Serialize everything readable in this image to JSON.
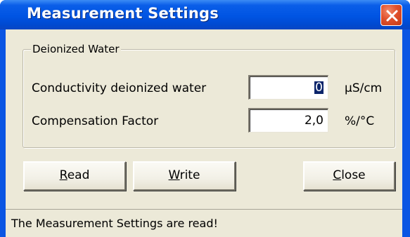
{
  "window": {
    "title": "Measurement Settings",
    "close_icon": "close-icon"
  },
  "group": {
    "legend": "Deionized Water"
  },
  "fields": {
    "conductivity": {
      "label": "Conductivity deionized water",
      "value": "0",
      "unit": "µS/cm"
    },
    "compensation": {
      "label": "Compensation Factor",
      "value": "2,0",
      "unit": "%/°C"
    }
  },
  "buttons": {
    "read": {
      "mnemonic": "R",
      "rest": "ead"
    },
    "write": {
      "mnemonic": "W",
      "rest": "rite"
    },
    "close": {
      "mnemonic": "C",
      "rest": "lose"
    }
  },
  "status": {
    "text": "The Measurement Settings are read!"
  },
  "colors": {
    "titlebar": "#0054e3",
    "client": "#ece9d8",
    "close_button": "#e0502c",
    "selection": "#0a246a"
  }
}
